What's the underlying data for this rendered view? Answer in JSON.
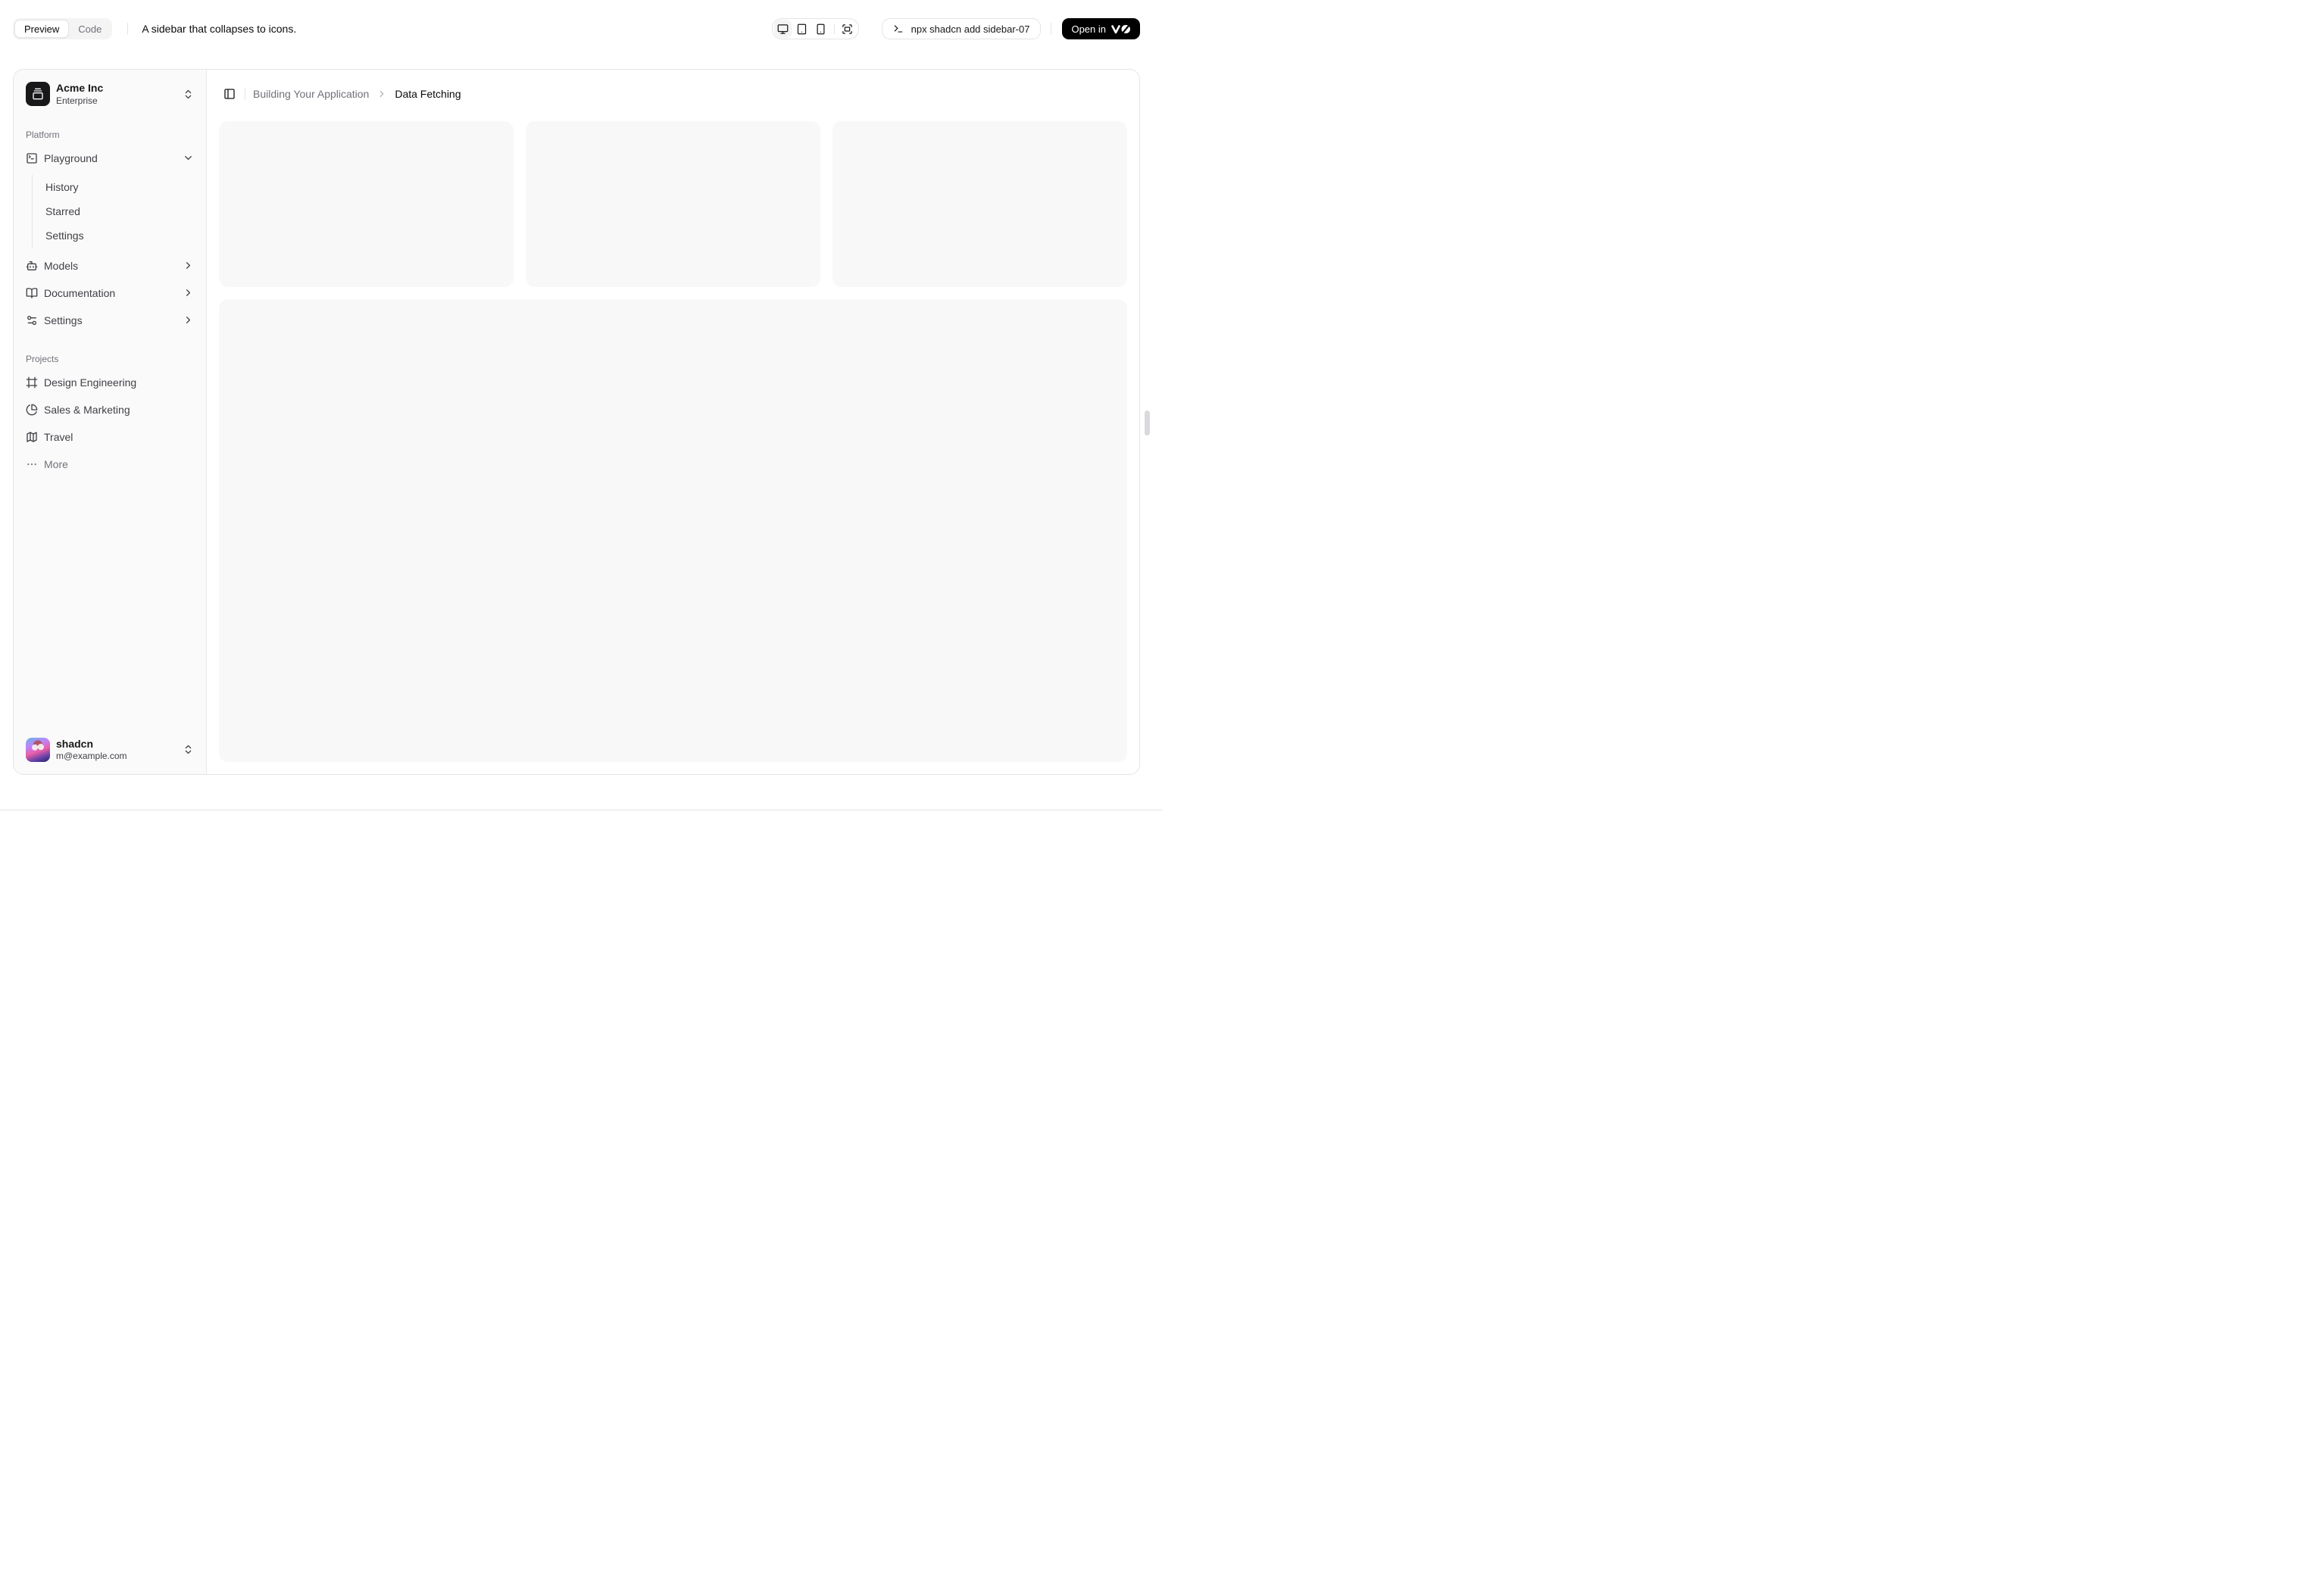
{
  "theme": {
    "accent_black": "#000000",
    "sidebar_bg": "#fafafa",
    "border": "#e4e4e7",
    "muted_text": "#71717a",
    "placeholder_bg": "#f8f8f9"
  },
  "toolbar": {
    "tabs": [
      {
        "label": "Preview",
        "active": true
      },
      {
        "label": "Code",
        "active": false
      }
    ],
    "description": "A sidebar that collapses to icons.",
    "device_icons": [
      "monitor-icon",
      "tablet-icon",
      "smartphone-icon",
      "fullscreen-icon"
    ],
    "command": "npx shadcn add sidebar-07",
    "open_in_label": "Open in",
    "open_in_logo": "v0-logo"
  },
  "sidebar": {
    "team": {
      "name": "Acme Inc",
      "plan": "Enterprise",
      "logo_icon": "gallery-vertical-end-icon"
    },
    "groups": [
      {
        "label": "Platform",
        "items": [
          {
            "label": "Playground",
            "icon": "square-terminal-icon",
            "expanded": true,
            "children": [
              "History",
              "Starred",
              "Settings"
            ]
          },
          {
            "label": "Models",
            "icon": "bot-icon"
          },
          {
            "label": "Documentation",
            "icon": "book-open-icon"
          },
          {
            "label": "Settings",
            "icon": "settings-icon"
          }
        ]
      },
      {
        "label": "Projects",
        "items": [
          {
            "label": "Design Engineering",
            "icon": "frame-icon"
          },
          {
            "label": "Sales & Marketing",
            "icon": "pie-chart-icon"
          },
          {
            "label": "Travel",
            "icon": "map-icon"
          },
          {
            "label": "More",
            "icon": "ellipsis-icon",
            "muted": true
          }
        ]
      }
    ],
    "user": {
      "name": "shadcn",
      "email": "m@example.com"
    }
  },
  "breadcrumb": {
    "parent": "Building Your Application",
    "current": "Data Fetching"
  }
}
